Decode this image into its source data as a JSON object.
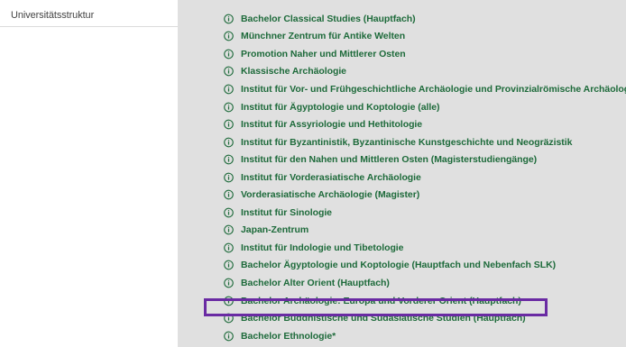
{
  "sidebar": {
    "title": "Universitätsstruktur"
  },
  "list": {
    "items": [
      {
        "label": "Bachelor Classical Studies (Hauptfach)"
      },
      {
        "label": "Münchner Zentrum für Antike Welten"
      },
      {
        "label": "Promotion Naher und Mittlerer Osten"
      },
      {
        "label": "Klassische Archäologie"
      },
      {
        "label": "Institut für Vor- und Frühgeschichtliche Archäologie und Provinzialrömische Archäologie"
      },
      {
        "label": "Institut für Ägyptologie und Koptologie (alle)"
      },
      {
        "label": "Institut für Assyriologie und Hethitologie"
      },
      {
        "label": "Institut für Byzantinistik, Byzantinische Kunstgeschichte und Neogräzistik"
      },
      {
        "label": "Institut für den Nahen und Mittleren Osten (Magisterstudiengänge)"
      },
      {
        "label": "Institut für Vorderasiatische Archäologie"
      },
      {
        "label": "Vorderasiatische Archäologie (Magister)"
      },
      {
        "label": "Institut für Sinologie"
      },
      {
        "label": "Japan-Zentrum"
      },
      {
        "label": "Institut für Indologie und Tibetologie"
      },
      {
        "label": "Bachelor Ägyptologie und Koptologie (Hauptfach und Nebenfach SLK)"
      },
      {
        "label": "Bachelor Alter Orient (Hauptfach)"
      },
      {
        "label": "Bachelor Archäologie: Europa und Vorderer Orient (Hauptfach)"
      },
      {
        "label": "Bachelor Buddhistische und Südasiatische Studien (Hauptfach)"
      },
      {
        "label": "Bachelor Ethnologie*"
      }
    ],
    "icon": "info-circle-icon",
    "highlighted_index": 16
  },
  "colors": {
    "link": "#1d6a3a",
    "panel_bg": "#e0e0e0",
    "highlight": "#6a2ba3"
  }
}
